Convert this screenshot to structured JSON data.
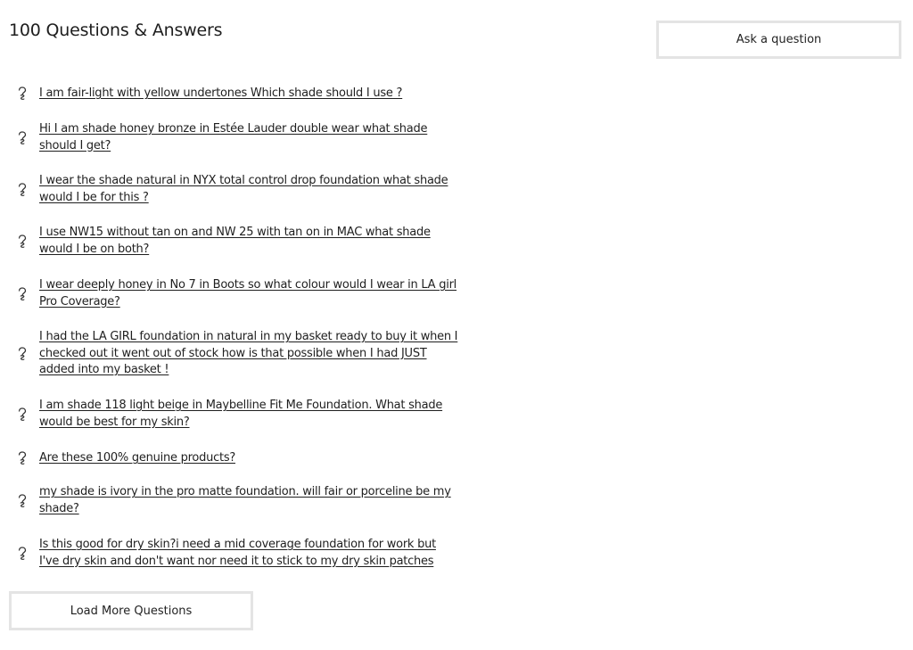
{
  "header": {
    "title": "100 Questions & Answers",
    "ask_button_label": "Ask a question"
  },
  "questions": [
    {
      "text": "I am fair-light with yellow undertones Which shade should I use ?"
    },
    {
      "text": "Hi I am shade honey bronze in Estée Lauder double wear what shade should I get? "
    },
    {
      "text": "I wear the shade natural in NYX total control drop foundation what shade would I be for this ? "
    },
    {
      "text": "I use NW15 without tan on and NW 25 with tan on in MAC what shade would I be on both?"
    },
    {
      "text": "I wear deeply honey in No 7 in Boots so what colour would I wear in LA girl Pro Coverage?"
    },
    {
      "text": "I had the LA GIRL foundation in natural in my basket ready to buy it when I checked out it went out of stock how is that possible when I had JUST added into my basket !"
    },
    {
      "text": "I am shade 118 light beige in Maybelline Fit Me Foundation. What shade would be best for my skin?"
    },
    {
      "text": "Are these 100% genuine products?"
    },
    {
      "text": "my shade is ivory in the pro matte foundation. will fair or porceline be my shade?"
    },
    {
      "text": "Is this good for dry skin?i need a mid coverage foundation for work but I've dry skin and don't want nor need it to stick to my dry skin patches "
    }
  ],
  "footer": {
    "load_more_label": "Load More Questions"
  },
  "icons": {
    "question": "question-mark-icon"
  }
}
